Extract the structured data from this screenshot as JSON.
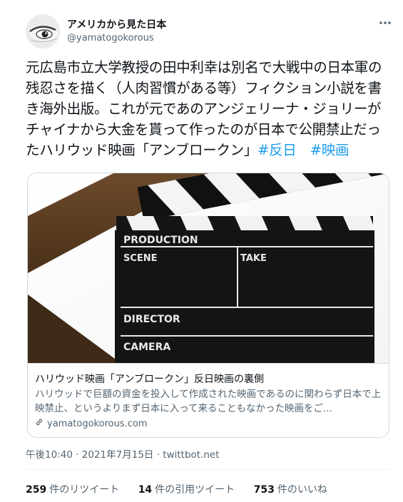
{
  "user": {
    "name": "アメリカから見た日本",
    "handle": "@yamatogokorous"
  },
  "tweet": {
    "text_main": "元広島市立大学教授の田中利幸は別名で大戦中の日本軍の残忍さを描く（人肉習慣がある等）フィクション小説を書き海外出版。これが元であのアンジェリーナ・ジョリーがチャイナから大金を貰って作ったのが日本で公開禁止だったハリウッド映画「アンブロークン」",
    "hashtag_1": "#反日",
    "hashtag_2": "#映画"
  },
  "card": {
    "image": {
      "production": "PRODUCTION",
      "scene": "SCENE",
      "take": "TAKE",
      "director": "DIRECTOR",
      "camera": "CAMERA"
    },
    "title": "ハリウッド映画「アンブロークン」反日映画の裏側",
    "description": "ハリウッドで巨額の資金を投入して作成された映画であるのに関わらず日本で上映禁止、というよりまず日本に入って来ることもなかった映画をご...",
    "domain": "yamatogokorous.com"
  },
  "meta": {
    "timestamp": "午後10:40 · 2021年7月15日 · twittbot.net"
  },
  "stats": {
    "retweets": "259",
    "retweets_label": "件のリツイート",
    "quotes": "14",
    "quotes_label": "件の引用ツイート",
    "likes": "753",
    "likes_label": "件のいいね"
  },
  "icons": {
    "more": "more-horizontal-icon",
    "link": "link-icon"
  }
}
